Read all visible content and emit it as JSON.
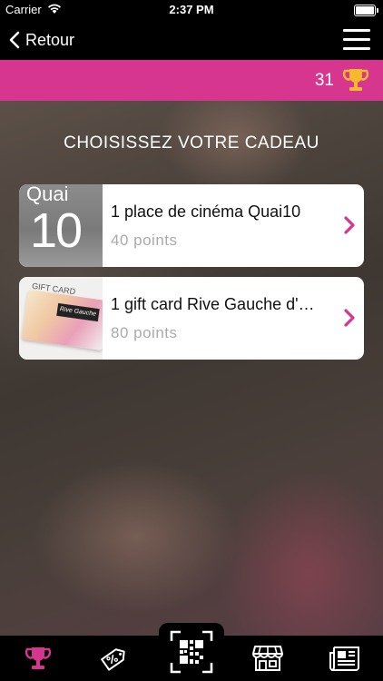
{
  "status_bar": {
    "carrier": "Carrier",
    "time": "2:37 PM"
  },
  "nav": {
    "back_label": "Retour"
  },
  "points_bar": {
    "count": "31"
  },
  "heading": "CHOISISSEZ VOTRE CADEAU",
  "rewards": [
    {
      "title": "1 place de cinéma Quai10",
      "points": "40 points",
      "thumb_text": "Quai",
      "thumb_number": "10"
    },
    {
      "title": "1 gift card Rive Gauche d'…",
      "points": "80 points",
      "thumb_text": "GIFT CARD",
      "thumb_brand": "Rive Gauche"
    }
  ],
  "tabs": [
    "trophy-icon",
    "coupon-icon",
    "qr-code-icon",
    "shop-icon",
    "news-icon"
  ],
  "colors": {
    "accent": "#d7368f",
    "bar": "#000000"
  }
}
